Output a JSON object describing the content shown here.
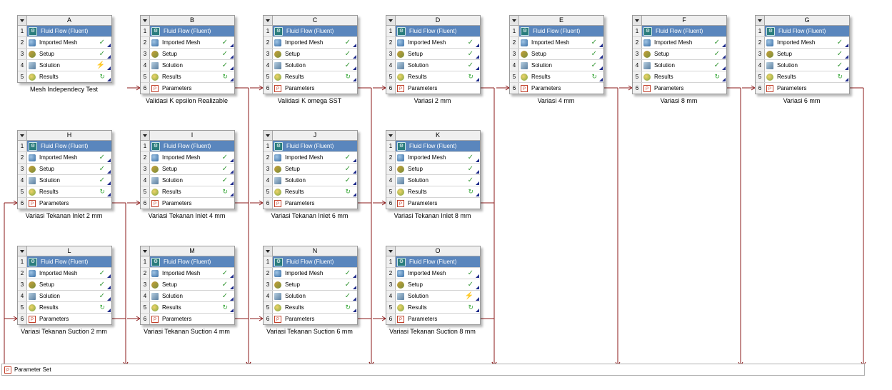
{
  "project_schematic": {
    "parameter_set": {
      "label": "Parameter Set",
      "icon": "parameter-icon"
    },
    "row_icons": [
      "fluent-icon",
      "mesh-icon",
      "setup-icon",
      "solution-icon",
      "results-icon",
      "parameter-icon"
    ],
    "status_icons": {
      "ok": "checkmark-icon",
      "update": "refresh-icon",
      "bolt": "lightning-icon"
    },
    "colors": {
      "header_row": "#5a86bd",
      "link_line": "#8b1a1a",
      "checkmark": "#3a9a3a"
    },
    "systems": [
      {
        "letter": "A",
        "caption": "Mesh Independecy Test",
        "has_params": false,
        "rows": [
          {
            "n": "1",
            "label": "Fluid Flow (Fluent)",
            "status": ""
          },
          {
            "n": "2",
            "label": "Imported Mesh",
            "status": "ok"
          },
          {
            "n": "3",
            "label": "Setup",
            "status": "ok"
          },
          {
            "n": "4",
            "label": "Solution",
            "status": "bolt"
          },
          {
            "n": "5",
            "label": "Results",
            "status": "update"
          }
        ]
      },
      {
        "letter": "B",
        "caption": "Validasi K epsilon Realizable",
        "has_params": true,
        "rows": [
          {
            "n": "1",
            "label": "Fluid Flow (Fluent)",
            "status": ""
          },
          {
            "n": "2",
            "label": "Imported Mesh",
            "status": "ok"
          },
          {
            "n": "3",
            "label": "Setup",
            "status": "ok"
          },
          {
            "n": "4",
            "label": "Solution",
            "status": "ok"
          },
          {
            "n": "5",
            "label": "Results",
            "status": "update"
          },
          {
            "n": "6",
            "label": "Parameters",
            "status": ""
          }
        ]
      },
      {
        "letter": "C",
        "caption": "Validasi K omega SST",
        "has_params": true,
        "rows": [
          {
            "n": "1",
            "label": "Fluid Flow (Fluent)",
            "status": ""
          },
          {
            "n": "2",
            "label": "Imported Mesh",
            "status": "ok"
          },
          {
            "n": "3",
            "label": "Setup",
            "status": "ok"
          },
          {
            "n": "4",
            "label": "Solution",
            "status": "ok"
          },
          {
            "n": "5",
            "label": "Results",
            "status": "update"
          },
          {
            "n": "6",
            "label": "Parameters",
            "status": ""
          }
        ]
      },
      {
        "letter": "D",
        "caption": "Variasi 2 mm",
        "has_params": true,
        "rows": [
          {
            "n": "1",
            "label": "Fluid Flow (Fluent)",
            "status": ""
          },
          {
            "n": "2",
            "label": "Imported Mesh",
            "status": "ok"
          },
          {
            "n": "3",
            "label": "Setup",
            "status": "ok"
          },
          {
            "n": "4",
            "label": "Solution",
            "status": "ok"
          },
          {
            "n": "5",
            "label": "Results",
            "status": "update"
          },
          {
            "n": "6",
            "label": "Parameters",
            "status": ""
          }
        ]
      },
      {
        "letter": "E",
        "caption": "Variasi 4 mm",
        "has_params": true,
        "rows": [
          {
            "n": "1",
            "label": "Fluid Flow (Fluent)",
            "status": ""
          },
          {
            "n": "2",
            "label": "Imported Mesh",
            "status": "ok"
          },
          {
            "n": "3",
            "label": "Setup",
            "status": "ok"
          },
          {
            "n": "4",
            "label": "Solution",
            "status": "ok"
          },
          {
            "n": "5",
            "label": "Results",
            "status": "update"
          },
          {
            "n": "6",
            "label": "Parameters",
            "status": ""
          }
        ]
      },
      {
        "letter": "F",
        "caption": "Variasi 8 mm",
        "has_params": true,
        "rows": [
          {
            "n": "1",
            "label": "Fluid Flow (Fluent)",
            "status": ""
          },
          {
            "n": "2",
            "label": "Imported Mesh",
            "status": "ok"
          },
          {
            "n": "3",
            "label": "Setup",
            "status": "ok"
          },
          {
            "n": "4",
            "label": "Solution",
            "status": "ok"
          },
          {
            "n": "5",
            "label": "Results",
            "status": "update"
          },
          {
            "n": "6",
            "label": "Parameters",
            "status": ""
          }
        ]
      },
      {
        "letter": "G",
        "caption": "Variasi 6 mm",
        "has_params": true,
        "rows": [
          {
            "n": "1",
            "label": "Fluid Flow (Fluent)",
            "status": ""
          },
          {
            "n": "2",
            "label": "Imported Mesh",
            "status": "ok"
          },
          {
            "n": "3",
            "label": "Setup",
            "status": "ok"
          },
          {
            "n": "4",
            "label": "Solution",
            "status": "ok"
          },
          {
            "n": "5",
            "label": "Results",
            "status": "update"
          },
          {
            "n": "6",
            "label": "Parameters",
            "status": ""
          }
        ]
      },
      {
        "letter": "H",
        "caption": "Variasi Tekanan Inlet 2 mm",
        "has_params": true,
        "rows": [
          {
            "n": "1",
            "label": "Fluid Flow (Fluent)",
            "status": ""
          },
          {
            "n": "2",
            "label": "Imported Mesh",
            "status": "ok"
          },
          {
            "n": "3",
            "label": "Setup",
            "status": "ok"
          },
          {
            "n": "4",
            "label": "Solution",
            "status": "ok"
          },
          {
            "n": "5",
            "label": "Results",
            "status": "update"
          },
          {
            "n": "6",
            "label": "Parameters",
            "status": ""
          }
        ]
      },
      {
        "letter": "I",
        "caption": "Variasi Tekanan Inlet 4 mm",
        "has_params": true,
        "rows": [
          {
            "n": "1",
            "label": "Fluid Flow (Fluent)",
            "status": ""
          },
          {
            "n": "2",
            "label": "Imported Mesh",
            "status": "ok"
          },
          {
            "n": "3",
            "label": "Setup",
            "status": "ok"
          },
          {
            "n": "4",
            "label": "Solution",
            "status": "ok"
          },
          {
            "n": "5",
            "label": "Results",
            "status": "update"
          },
          {
            "n": "6",
            "label": "Parameters",
            "status": ""
          }
        ]
      },
      {
        "letter": "J",
        "caption": "Variasi Tekanan Inlet 6 mm",
        "has_params": true,
        "rows": [
          {
            "n": "1",
            "label": "Fluid Flow (Fluent)",
            "status": ""
          },
          {
            "n": "2",
            "label": "Imported Mesh",
            "status": "ok"
          },
          {
            "n": "3",
            "label": "Setup",
            "status": "ok"
          },
          {
            "n": "4",
            "label": "Solution",
            "status": "ok"
          },
          {
            "n": "5",
            "label": "Results",
            "status": "update"
          },
          {
            "n": "6",
            "label": "Parameters",
            "status": ""
          }
        ]
      },
      {
        "letter": "K",
        "caption": "Variasi Tekanan Inlet 8 mm",
        "has_params": true,
        "rows": [
          {
            "n": "1",
            "label": "Fluid Flow (Fluent)",
            "status": ""
          },
          {
            "n": "2",
            "label": "Imported Mesh",
            "status": "ok"
          },
          {
            "n": "3",
            "label": "Setup",
            "status": "ok"
          },
          {
            "n": "4",
            "label": "Solution",
            "status": "ok"
          },
          {
            "n": "5",
            "label": "Results",
            "status": "update"
          },
          {
            "n": "6",
            "label": "Parameters",
            "status": ""
          }
        ]
      },
      {
        "letter": "L",
        "caption": "Variasi Tekanan Suction 2 mm",
        "has_params": true,
        "rows": [
          {
            "n": "1",
            "label": "Fluid Flow (Fluent)",
            "status": ""
          },
          {
            "n": "2",
            "label": "Imported Mesh",
            "status": "ok"
          },
          {
            "n": "3",
            "label": "Setup",
            "status": "ok"
          },
          {
            "n": "4",
            "label": "Solution",
            "status": "ok"
          },
          {
            "n": "5",
            "label": "Results",
            "status": "update"
          },
          {
            "n": "6",
            "label": "Parameters",
            "status": ""
          }
        ]
      },
      {
        "letter": "M",
        "caption": "Variasi Tekanan Suction 4 mm",
        "has_params": true,
        "rows": [
          {
            "n": "1",
            "label": "Fluid Flow (Fluent)",
            "status": ""
          },
          {
            "n": "2",
            "label": "Imported Mesh",
            "status": "ok"
          },
          {
            "n": "3",
            "label": "Setup",
            "status": "ok"
          },
          {
            "n": "4",
            "label": "Solution",
            "status": "ok"
          },
          {
            "n": "5",
            "label": "Results",
            "status": "update"
          },
          {
            "n": "6",
            "label": "Parameters",
            "status": ""
          }
        ]
      },
      {
        "letter": "N",
        "caption": "Variasi Tekanan Suction 6 mm",
        "has_params": true,
        "rows": [
          {
            "n": "1",
            "label": "Fluid Flow (Fluent)",
            "status": ""
          },
          {
            "n": "2",
            "label": "Imported Mesh",
            "status": "ok"
          },
          {
            "n": "3",
            "label": "Setup",
            "status": "ok"
          },
          {
            "n": "4",
            "label": "Solution",
            "status": "ok"
          },
          {
            "n": "5",
            "label": "Results",
            "status": "update"
          },
          {
            "n": "6",
            "label": "Parameters",
            "status": ""
          }
        ]
      },
      {
        "letter": "O",
        "caption": "Variasi Tekanan Suction 8 mm",
        "has_params": true,
        "rows": [
          {
            "n": "1",
            "label": "Fluid Flow (Fluent)",
            "status": ""
          },
          {
            "n": "2",
            "label": "Imported Mesh",
            "status": "ok"
          },
          {
            "n": "3",
            "label": "Setup",
            "status": "ok"
          },
          {
            "n": "4",
            "label": "Solution",
            "status": "bolt"
          },
          {
            "n": "5",
            "label": "Results",
            "status": "update"
          },
          {
            "n": "6",
            "label": "Parameters",
            "status": ""
          }
        ]
      }
    ]
  }
}
